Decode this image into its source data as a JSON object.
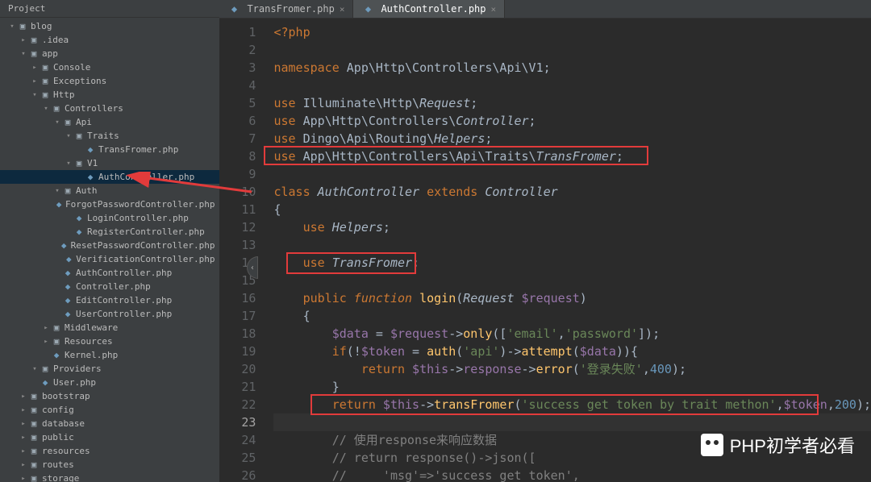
{
  "panel_title": "Project",
  "project_tree": [
    {
      "indent": 0,
      "arrow": "▾",
      "icon": "folder",
      "label": "blog"
    },
    {
      "indent": 1,
      "arrow": "▸",
      "icon": "folder",
      "label": ".idea"
    },
    {
      "indent": 1,
      "arrow": "▾",
      "icon": "folder",
      "label": "app"
    },
    {
      "indent": 2,
      "arrow": "▸",
      "icon": "folder",
      "label": "Console"
    },
    {
      "indent": 2,
      "arrow": "▸",
      "icon": "folder",
      "label": "Exceptions"
    },
    {
      "indent": 2,
      "arrow": "▾",
      "icon": "folder",
      "label": "Http"
    },
    {
      "indent": 3,
      "arrow": "▾",
      "icon": "folder",
      "label": "Controllers"
    },
    {
      "indent": 4,
      "arrow": "▾",
      "icon": "folder",
      "label": "Api"
    },
    {
      "indent": 5,
      "arrow": "▾",
      "icon": "folder",
      "label": "Traits"
    },
    {
      "indent": 6,
      "arrow": "",
      "icon": "php",
      "label": "TransFromer.php"
    },
    {
      "indent": 5,
      "arrow": "▾",
      "icon": "folder",
      "label": "V1"
    },
    {
      "indent": 6,
      "arrow": "",
      "icon": "php",
      "label": "AuthController.php",
      "selected": true
    },
    {
      "indent": 4,
      "arrow": "▾",
      "icon": "folder",
      "label": "Auth"
    },
    {
      "indent": 5,
      "arrow": "",
      "icon": "php",
      "label": "ForgotPasswordController.php"
    },
    {
      "indent": 5,
      "arrow": "",
      "icon": "php",
      "label": "LoginController.php"
    },
    {
      "indent": 5,
      "arrow": "",
      "icon": "php",
      "label": "RegisterController.php"
    },
    {
      "indent": 5,
      "arrow": "",
      "icon": "php",
      "label": "ResetPasswordController.php"
    },
    {
      "indent": 5,
      "arrow": "",
      "icon": "php",
      "label": "VerificationController.php"
    },
    {
      "indent": 4,
      "arrow": "",
      "icon": "php",
      "label": "AuthController.php"
    },
    {
      "indent": 4,
      "arrow": "",
      "icon": "php",
      "label": "Controller.php"
    },
    {
      "indent": 4,
      "arrow": "",
      "icon": "php",
      "label": "EditController.php"
    },
    {
      "indent": 4,
      "arrow": "",
      "icon": "php",
      "label": "UserController.php"
    },
    {
      "indent": 3,
      "arrow": "▸",
      "icon": "folder",
      "label": "Middleware"
    },
    {
      "indent": 3,
      "arrow": "▸",
      "icon": "folder",
      "label": "Resources"
    },
    {
      "indent": 3,
      "arrow": "",
      "icon": "php",
      "label": "Kernel.php"
    },
    {
      "indent": 2,
      "arrow": "▾",
      "icon": "folder",
      "label": "Providers"
    },
    {
      "indent": 2,
      "arrow": "",
      "icon": "php",
      "label": "User.php"
    },
    {
      "indent": 1,
      "arrow": "▸",
      "icon": "folder",
      "label": "bootstrap"
    },
    {
      "indent": 1,
      "arrow": "▸",
      "icon": "folder",
      "label": "config"
    },
    {
      "indent": 1,
      "arrow": "▸",
      "icon": "folder",
      "label": "database"
    },
    {
      "indent": 1,
      "arrow": "▸",
      "icon": "folder",
      "label": "public"
    },
    {
      "indent": 1,
      "arrow": "▸",
      "icon": "folder",
      "label": "resources"
    },
    {
      "indent": 1,
      "arrow": "▸",
      "icon": "folder",
      "label": "routes"
    },
    {
      "indent": 1,
      "arrow": "▸",
      "icon": "folder",
      "label": "storage"
    }
  ],
  "tabs": [
    {
      "icon": "php",
      "label": "TransFromer.php",
      "active": false
    },
    {
      "icon": "php",
      "label": "AuthController.php",
      "active": true
    }
  ],
  "editor": {
    "first_line": 1,
    "last_line": 26,
    "current_line": 23,
    "lines": [
      {
        "n": 1,
        "text": "<?php",
        "cls": "tag"
      },
      {
        "n": 2,
        "text": ""
      },
      {
        "n": 3,
        "html": "<span class='kw'>namespace</span> <span class='ns'>App\\Http\\Controllers\\Api\\V1</span>;"
      },
      {
        "n": 4,
        "text": ""
      },
      {
        "n": 5,
        "html": "<span class='kw'>use</span> <span class='ns'>Illuminate\\Http\\</span><span class='itf'>Request</span>;"
      },
      {
        "n": 6,
        "html": "<span class='kw'>use</span> <span class='ns'>App\\Http\\Controllers\\</span><span class='itf'>Controller</span>;"
      },
      {
        "n": 7,
        "html": "<span class='kw'>use</span> <span class='ns'>Dingo\\Api\\Routing\\</span><span class='itf'>Helpers</span>;"
      },
      {
        "n": 8,
        "html": "<span class='kw'>use</span> <span class='ns'>App\\Http\\Controllers\\Api\\Traits\\</span><span class='itf'>TransFromer</span>;"
      },
      {
        "n": 9,
        "text": ""
      },
      {
        "n": 10,
        "html": "<span class='kw'>class</span> <span class='cls'>AuthController</span> <span class='kw'>extends</span> <span class='itf'>Controller</span>"
      },
      {
        "n": 11,
        "html": "{"
      },
      {
        "n": 12,
        "html": "    <span class='kw'>use</span> <span class='itf'>Helpers</span>;"
      },
      {
        "n": 13,
        "text": ""
      },
      {
        "n": 14,
        "html": "    <span class='kw'>use</span> <span class='itf'>TransFromer</span>;"
      },
      {
        "n": 15,
        "text": ""
      },
      {
        "n": 16,
        "html": "    <span class='kw'>public</span> <span class='fn-kw'>function</span> <span class='mtd'>login</span>(<span class='cls'>Request</span> <span class='var'>$request</span>)"
      },
      {
        "n": 17,
        "html": "    {"
      },
      {
        "n": 18,
        "html": "        <span class='var'>$data</span> = <span class='var'>$request</span>-&gt;<span class='mtd'>only</span>([<span class='str'>'email'</span>,<span class='str'>'password'</span>]);"
      },
      {
        "n": 19,
        "html": "        <span class='kw'>if</span>(!<span class='var'>$token</span> = <span class='mtd'>auth</span>(<span class='str'>'api'</span>)-&gt;<span class='mtd'>attempt</span>(<span class='var'>$data</span>)){"
      },
      {
        "n": 20,
        "html": "            <span class='kw'>return</span> <span class='var'>$this</span>-&gt;<span class='var'>response</span>-&gt;<span class='mtd'>error</span>(<span class='str'>'登录失败'</span>,<span class='num'>400</span>);"
      },
      {
        "n": 21,
        "html": "        }"
      },
      {
        "n": 22,
        "html": "        <span class='kw'>return</span> <span class='var'>$this</span>-&gt;<span class='mtd'>transFromer</span>(<span class='str'>'success get token by trait methon'</span>,<span class='var'>$token</span>,<span class='num'>200</span>);"
      },
      {
        "n": 23,
        "text": ""
      },
      {
        "n": 24,
        "html": "        <span class='com'>// 使用response来响应数据</span>"
      },
      {
        "n": 25,
        "html": "        <span class='com'>// return response()-&gt;json([</span>"
      },
      {
        "n": 26,
        "html": "        <span class='com'>//     'msg'=&gt;'success get token',</span>"
      }
    ]
  },
  "watermark": "PHP初学者必看"
}
